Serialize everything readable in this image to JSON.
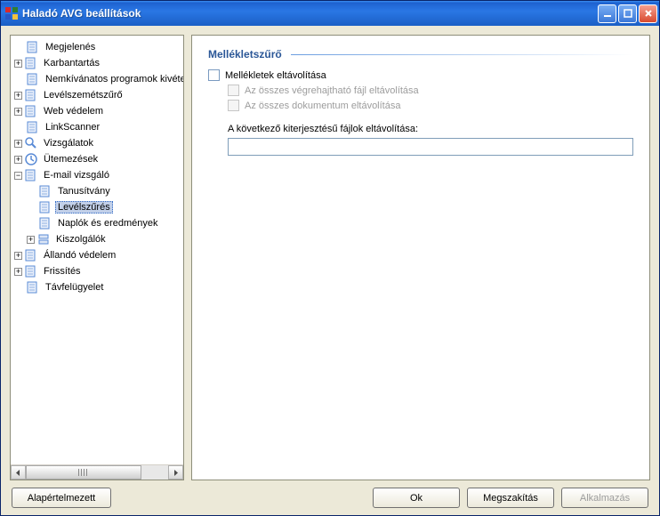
{
  "window": {
    "title": "Haladó AVG beállítások"
  },
  "tree": {
    "items": [
      {
        "label": "Megjelenés",
        "exp": ""
      },
      {
        "label": "Karbantartás",
        "exp": "+"
      },
      {
        "label": "Nemkívánatos programok kivételei",
        "exp": ""
      },
      {
        "label": "Levélszemétszűrő",
        "exp": "+"
      },
      {
        "label": "Web védelem",
        "exp": "+"
      },
      {
        "label": "LinkScanner",
        "exp": ""
      },
      {
        "label": "Vizsgálatok",
        "exp": "+"
      },
      {
        "label": "Ütemezések",
        "exp": "+"
      },
      {
        "label": "E-mail vizsgáló",
        "exp": "-",
        "children": [
          {
            "label": "Tanusítvány"
          },
          {
            "label": "Levélszűrés",
            "selected": true
          },
          {
            "label": "Naplók és eredmények"
          },
          {
            "label": "Kiszolgálók",
            "exp": "+"
          }
        ]
      },
      {
        "label": "Állandó védelem",
        "exp": "+"
      },
      {
        "label": "Frissítés",
        "exp": "+"
      },
      {
        "label": "Távfelügyelet",
        "exp": ""
      }
    ]
  },
  "content": {
    "section_title": "Mellékletszűrő",
    "remove_attachments": "Mellékletek eltávolítása",
    "remove_executables": "Az összes végrehajtható fájl eltávolítása",
    "remove_documents": "Az összes dokumentum eltávolítása",
    "extensions_label": "A következő kiterjesztésű fájlok eltávolítása:",
    "extensions_value": ""
  },
  "buttons": {
    "defaults": "Alapértelmezett",
    "ok": "Ok",
    "cancel": "Megszakítás",
    "apply": "Alkalmazás"
  },
  "exp_plus": "+",
  "exp_minus": "−"
}
